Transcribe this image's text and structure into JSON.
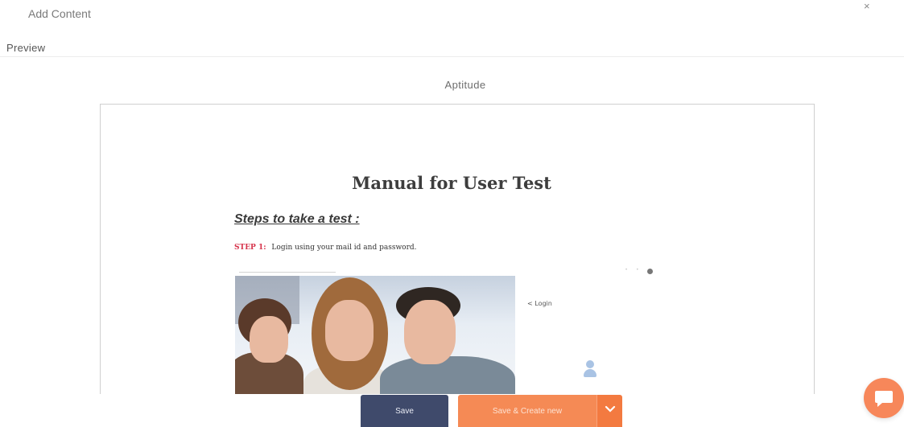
{
  "modal": {
    "title": "Add Content",
    "close_glyph": "×",
    "preview_label": "Preview",
    "section_title": "Aptitude"
  },
  "document": {
    "title": "Manual for User Test",
    "subtitle": "Steps to take a test :",
    "step_label": "STEP 1:",
    "step_text": "Login using your mail id and password.",
    "login_link": "< Login"
  },
  "actions": {
    "save_label": "Save",
    "save_create_label": "Save & Create new"
  },
  "icons": {
    "close": "close-icon",
    "dropdown": "chevron-down-icon",
    "chat": "chat-icon",
    "user": "user-icon"
  },
  "colors": {
    "save_button": "#3f4a6b",
    "save_create_button": "#f58a55",
    "chat_button": "#f7875a",
    "step_label": "#d6334b"
  }
}
